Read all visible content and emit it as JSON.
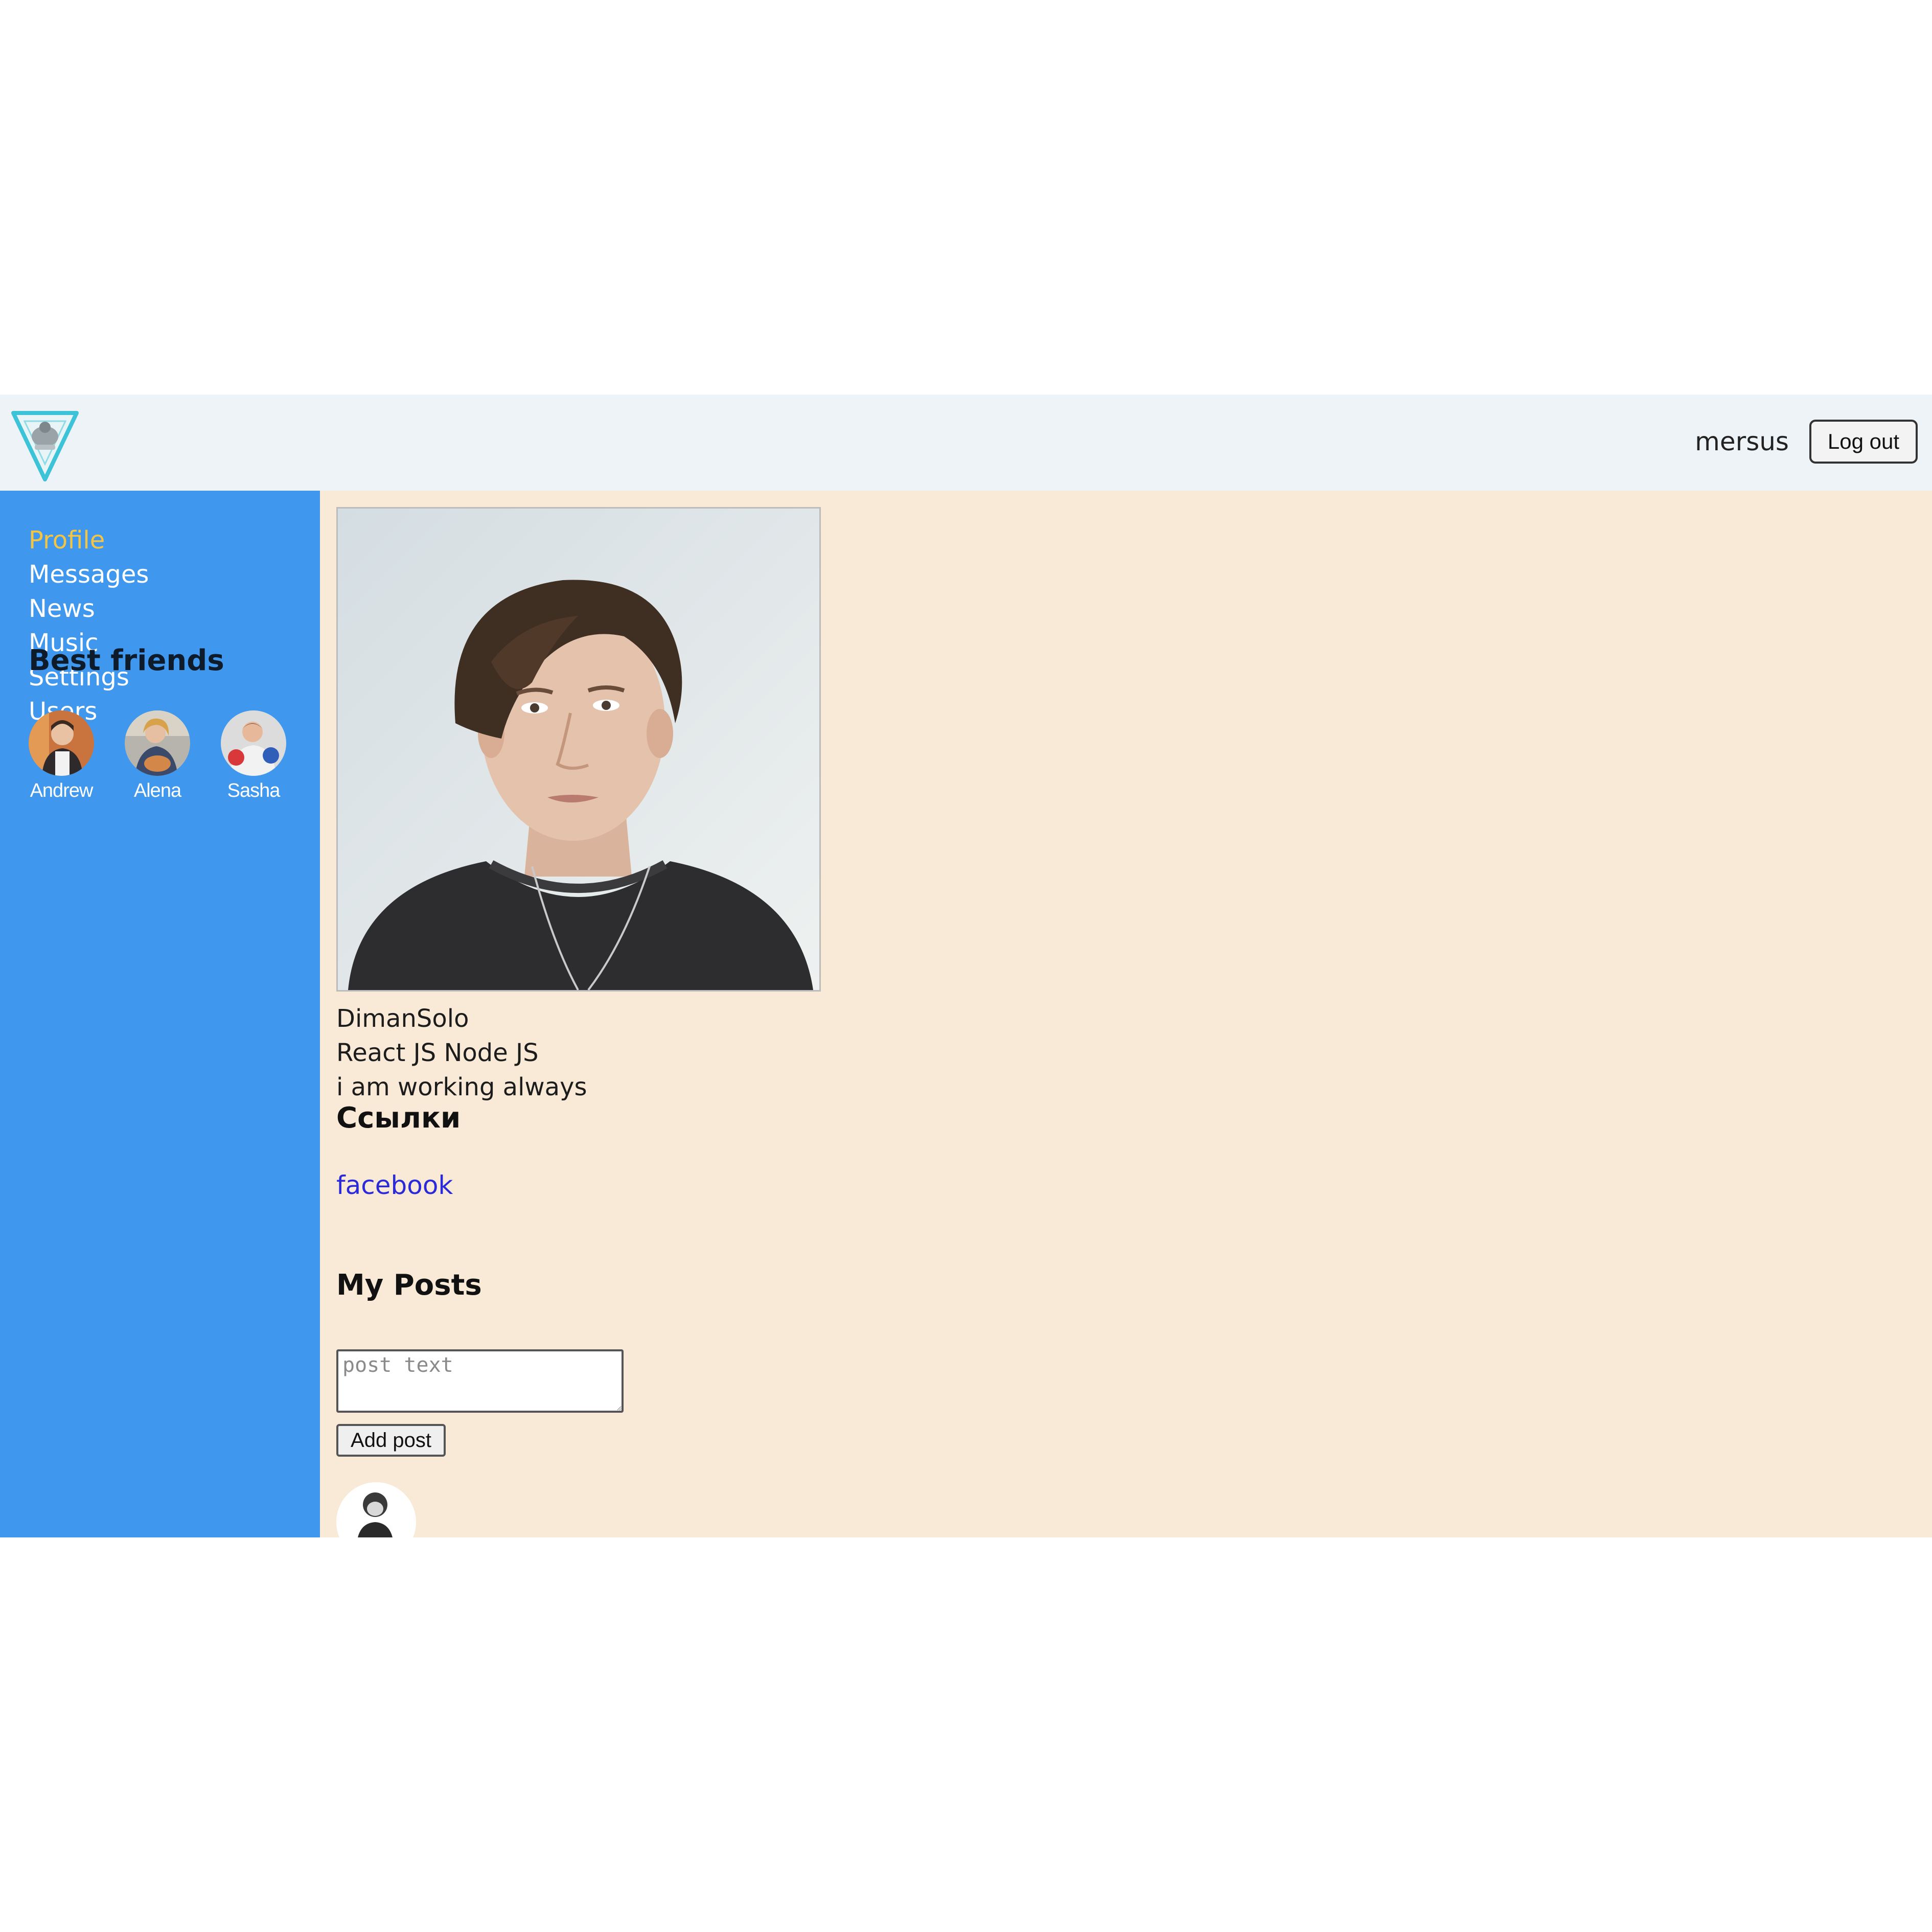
{
  "header": {
    "logo_icon": "diamond-logo-icon",
    "login_name": "mersus",
    "logout_label": "Log out"
  },
  "sidebar": {
    "nav": [
      {
        "label": "Profile",
        "active": true
      },
      {
        "label": "Messages",
        "active": false
      },
      {
        "label": "News",
        "active": false
      },
      {
        "label": "Music",
        "active": false
      },
      {
        "label": "Settings",
        "active": false
      },
      {
        "label": "Users",
        "active": false
      }
    ],
    "friends_title": "Best friends",
    "friends": [
      {
        "name": "Andrew"
      },
      {
        "name": "Alena"
      },
      {
        "name": "Sasha"
      }
    ]
  },
  "profile": {
    "full_name": "DimanSolo",
    "skills": "React JS Node JS",
    "status": "i am working always",
    "links_title": "Ссылки",
    "links": [
      {
        "label": "facebook"
      }
    ]
  },
  "posts": {
    "title": "My Posts",
    "input_placeholder": "post text",
    "input_value": "",
    "add_button_label": "Add post"
  },
  "colors": {
    "sidebar_bg": "#3f97ee",
    "content_bg": "#f8ead6",
    "header_bg": "#eef3f8",
    "active_nav": "#f4c542",
    "link": "#2a2ad8"
  }
}
